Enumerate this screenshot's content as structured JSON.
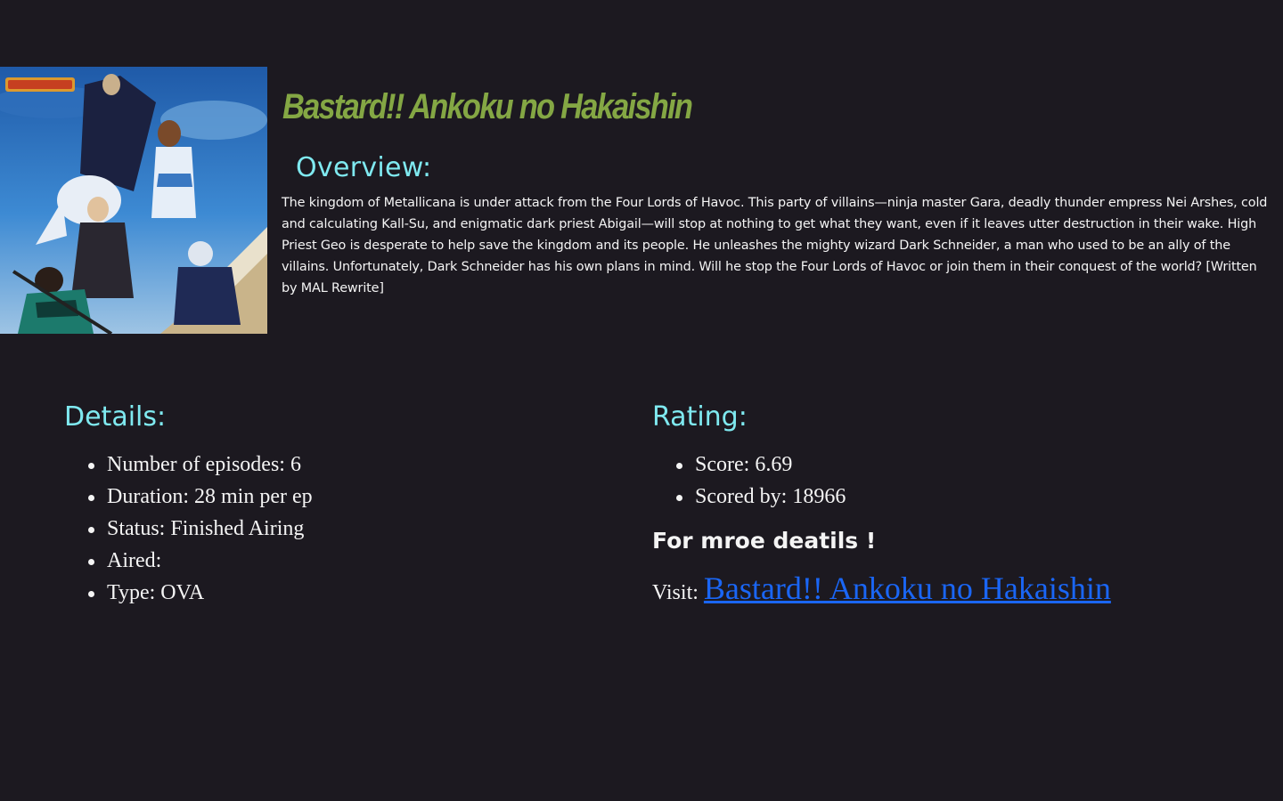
{
  "anime": {
    "title": "Bastard!! Ankoku no Hakaishin",
    "cover_alt": "Bastard!!"
  },
  "overview": {
    "heading": "Overview:",
    "text": "The kingdom of Metallicana is under attack from the Four Lords of Havoc. This party of villains—ninja master Gara, deadly thunder empress Nei Arshes, cold and calculating Kall-Su, and enigmatic dark priest Abigail—will stop at nothing to get what they want, even if it leaves utter destruction in their wake. High Priest Geo is desperate to help save the kingdom and its people. He unleashes the mighty wizard Dark Schneider, a man who used to be an ally of the villains. Unfortunately, Dark Schneider has his own plans in mind. Will he stop the Four Lords of Havoc or join them in their conquest of the world? [Written by MAL Rewrite]"
  },
  "details": {
    "heading": "Details:",
    "items": [
      "Number of episodes: 6",
      "Duration: 28 min per ep",
      "Status: Finished Airing",
      "Aired:",
      "Type: OVA"
    ]
  },
  "rating": {
    "heading": "Rating:",
    "items": [
      "Score: 6.69",
      "Scored by: 18966"
    ]
  },
  "more": {
    "heading": "For mroe deatils !",
    "visit_label": "Visit:",
    "link_text": "Bastard!! Ankoku no Hakaishin"
  },
  "colors": {
    "background": "#1c1920",
    "title": "#84a744",
    "heading": "#7fe9f0",
    "text": "#f4f4f4",
    "link": "#1a66f5"
  }
}
